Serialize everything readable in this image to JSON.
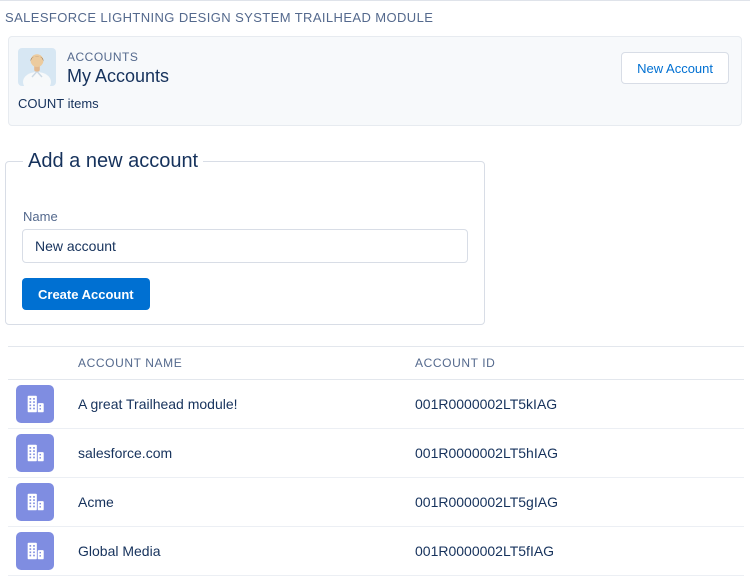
{
  "page": {
    "title": "SALESFORCE LIGHTNING DESIGN SYSTEM TRAILHEAD MODULE"
  },
  "header": {
    "object_label": "ACCOUNTS",
    "title": "My Accounts",
    "count_text": "COUNT items",
    "new_account_button": "New Account",
    "avatar_icon": "user-avatar"
  },
  "form": {
    "legend": "Add a new account",
    "name_label": "Name",
    "name_value": "New account",
    "create_button": "Create Account"
  },
  "table": {
    "columns": [
      "ACCOUNT NAME",
      "ACCOUNT ID"
    ],
    "row_icon": "building-icon",
    "rows": [
      {
        "name": "A great Trailhead module!",
        "id": "001R0000002LT5kIAG"
      },
      {
        "name": "salesforce.com",
        "id": "001R0000002LT5hIAG"
      },
      {
        "name": "Acme",
        "id": "001R0000002LT5gIAG"
      },
      {
        "name": "Global Media",
        "id": "001R0000002LT5fIAG"
      }
    ]
  },
  "colors": {
    "brand_blue": "#0070d2",
    "text_dark": "#16325c",
    "text_label": "#54698d",
    "border": "#d8dde6",
    "header_bg": "#f7f9fb",
    "account_icon_bg": "#7f8de1",
    "avatar_bg": "#d7e7f3"
  }
}
